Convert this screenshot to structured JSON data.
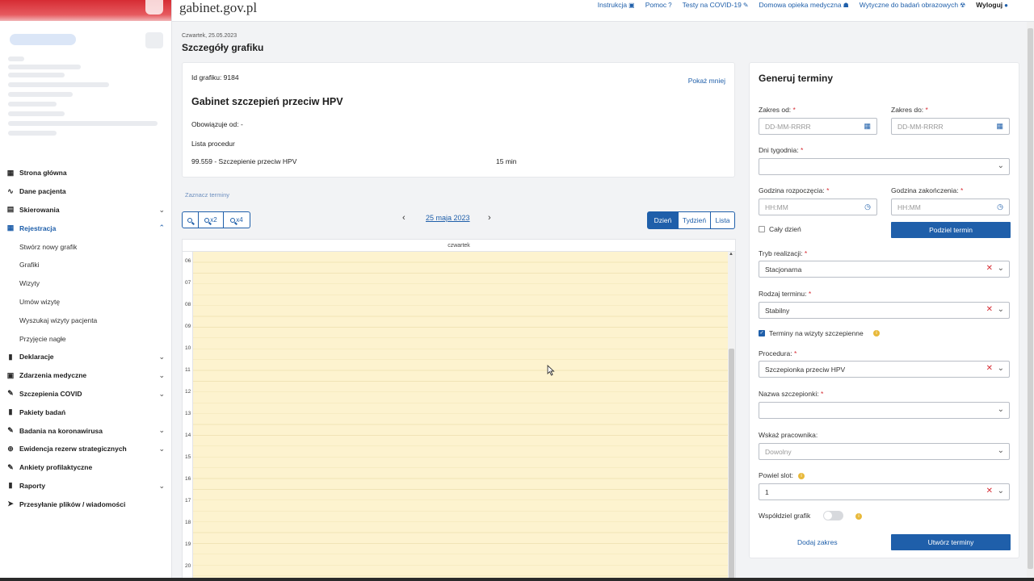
{
  "header": {
    "brand": "gabinet.gov.pl",
    "links": [
      {
        "label": "Instrukcja",
        "icon": "book-icon",
        "glyph": "▣"
      },
      {
        "label": "Pomoc",
        "icon": "help-icon",
        "glyph": "?"
      },
      {
        "label": "Testy na COVID-19",
        "icon": "pencil-icon",
        "glyph": "✎"
      },
      {
        "label": "Domowa opieka medyczna",
        "icon": "people-icon",
        "glyph": "☗"
      },
      {
        "label": "Wytyczne do badań obrazowych",
        "icon": "radiation-icon",
        "glyph": "☢"
      },
      {
        "label": "Wyloguj",
        "icon": "user-icon",
        "glyph": "●"
      }
    ]
  },
  "sidebar": {
    "items": [
      {
        "label": "Strona główna",
        "icon": "grid-icon",
        "glyph": "▦",
        "chevron": ""
      },
      {
        "label": "Dane pacjenta",
        "icon": "stethoscope-icon",
        "glyph": "∿",
        "chevron": ""
      },
      {
        "label": "Skierowania",
        "icon": "document-icon",
        "glyph": "▤",
        "chevron": "⌄"
      },
      {
        "label": "Rejestracja",
        "icon": "calendar-icon",
        "glyph": "▦",
        "chevron": "⌃"
      }
    ],
    "subitems": [
      "Stwórz nowy grafik",
      "Grafiki",
      "Wizyty",
      "Umów wizytę",
      "Wyszukaj wizyty pacjenta",
      "Przyjęcie nagłe"
    ],
    "items_after": [
      {
        "label": "Deklaracje",
        "icon": "declaration-icon",
        "glyph": "▮",
        "chevron": "⌄"
      },
      {
        "label": "Zdarzenia medyczne",
        "icon": "medical-event-icon",
        "glyph": "▣",
        "chevron": "⌄"
      },
      {
        "label": "Szczepienia COVID",
        "icon": "syringe-icon",
        "glyph": "✎",
        "chevron": "⌄"
      },
      {
        "label": "Pakiety badań",
        "icon": "package-icon",
        "glyph": "▮",
        "chevron": ""
      },
      {
        "label": "Badania na koronawirusa",
        "icon": "virus-test-icon",
        "glyph": "✎",
        "chevron": "⌄"
      },
      {
        "label": "Ewidencja rezerw strategicznych",
        "icon": "reserve-icon",
        "glyph": "⊕",
        "chevron": "⌄"
      },
      {
        "label": "Ankiety profilaktyczne",
        "icon": "survey-icon",
        "glyph": "✎",
        "chevron": ""
      },
      {
        "label": "Raporty",
        "icon": "report-icon",
        "glyph": "▮",
        "chevron": "⌄"
      },
      {
        "label": "Przesyłanie plików / wiadomości",
        "icon": "send-icon",
        "glyph": "➤",
        "chevron": ""
      }
    ]
  },
  "page": {
    "date": "Czwartek, 25.05.2023",
    "title": "Szczegóły grafiku"
  },
  "schedule": {
    "id_line": "Id grafiku: 9184",
    "show_less": "Pokaż mniej",
    "name": "Gabinet szczepień przeciw HPV",
    "valid_from": "Obowiązuje od: -",
    "procedures_label": "Lista procedur",
    "procedure": "99.559 - Szczepienie przeciw HPV",
    "duration": "15 min"
  },
  "calendar": {
    "mark_terms": "Zaznacz terminy",
    "zoom": [
      "",
      "x2",
      "x4"
    ],
    "date_label": "25 maja 2023",
    "prev": "‹",
    "next": "›",
    "views": [
      "Dzień",
      "Tydzień",
      "Lista"
    ],
    "day_header": "czwartek",
    "hours": [
      "06",
      "07",
      "08",
      "09",
      "10",
      "11",
      "12",
      "13",
      "14",
      "15",
      "16",
      "17",
      "18",
      "19",
      "20"
    ]
  },
  "panel": {
    "title": "Generuj terminy",
    "range_from_label": "Zakres od:",
    "range_to_label": "Zakres do:",
    "date_placeholder": "DD-MM-RRRR",
    "weekdays_label": "Dni tygodnia:",
    "start_label": "Godzina rozpoczęcia:",
    "end_label": "Godzina zakończenia:",
    "time_placeholder": "HH:MM",
    "whole_day": "Cały dzień",
    "split_button": "Podziel termin",
    "mode_label": "Tryb realizacji:",
    "mode_value": "Stacjonarna",
    "type_label": "Rodzaj terminu:",
    "type_value": "Stabilny",
    "vaccine_terms": "Terminy na wizyty szczepienne",
    "procedure_label": "Procedura:",
    "procedure_value": "Szczepionka przeciw HPV",
    "vaccine_name_label": "Nazwa szczepionki:",
    "employee_label": "Wskaż pracownika:",
    "employee_value": "Dowolny",
    "repeat_label": "Powiel slot:",
    "repeat_value": "1",
    "share_label": "Współdziel grafik",
    "add_range": "Dodaj zakres",
    "create_button": "Utwórz terminy"
  },
  "colors": {
    "accent": "#1f5faa",
    "calendar_bg": "#fdf3cf",
    "required": "#d62c34",
    "info": "#e8b93b"
  }
}
